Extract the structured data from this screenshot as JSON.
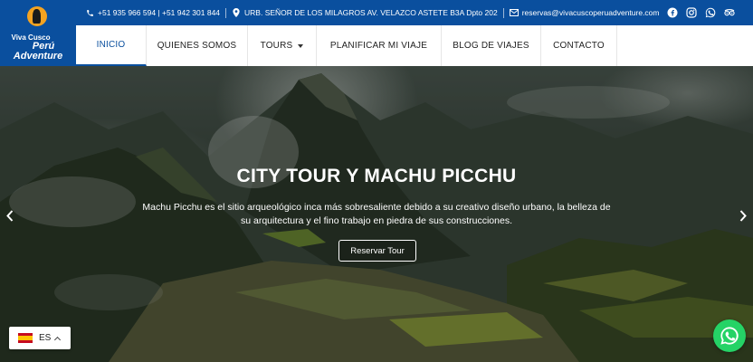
{
  "logo": {
    "line1": "Viva Cusco",
    "line2": "Perú",
    "line3": "Adventure"
  },
  "topbar": {
    "phones": "+51 935 966 594 | +51 942 301 844",
    "address": "URB. SEÑOR DE LOS MILAGROS AV. VELAZCO ASTETE B3A Dpto 202",
    "email": "reservas@vivacuscoperuadventure.com",
    "social_icons": [
      "facebook-icon",
      "instagram-icon",
      "whatsapp-icon",
      "tripadvisor-icon"
    ]
  },
  "nav": {
    "items": [
      {
        "label": "INICIO",
        "active": true
      },
      {
        "label": "QUIENES SOMOS"
      },
      {
        "label": "TOURS",
        "has_dropdown": true
      },
      {
        "label": "PLANIFICAR MI VIAJE"
      },
      {
        "label": "BLOG DE VIAJES"
      },
      {
        "label": "CONTACTO"
      }
    ]
  },
  "hero": {
    "title": "CITY TOUR Y MACHU PICCHU",
    "description": "Machu Picchu es el sitio arqueológico inca más sobresaliente debido a su creativo diseño urbano, la belleza de su arquitectura y el fino trabajo en piedra de sus construcciones.",
    "button_label": "Reservar Tour"
  },
  "language": {
    "code": "ES"
  },
  "colors": {
    "brand_blue": "#0a4f9e",
    "whatsapp_green": "#25d366"
  }
}
